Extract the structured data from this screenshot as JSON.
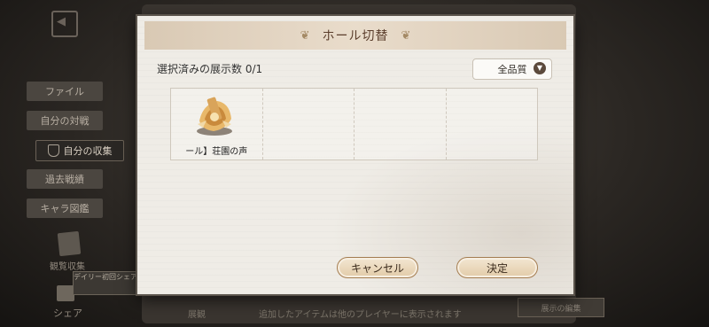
{
  "background": {
    "sidebar": [
      {
        "label": "ファイル",
        "active": false
      },
      {
        "label": "自分の対戦",
        "active": false
      },
      {
        "label": "自分の収集",
        "active": true
      },
      {
        "label": "過去戦績",
        "active": false
      },
      {
        "label": "キャラ図鑑",
        "active": false
      }
    ],
    "album_label": "観覧収集",
    "daily_label": "デイリー初回シェア",
    "share_label": "シェア",
    "bottom_left": "展観",
    "bottom_text": "追加したアイテムは他のプレイヤーに表示されます",
    "bottom_button": "展示の編集"
  },
  "dialog": {
    "title": "ホール切替",
    "selected_count": "選択済みの展示数 0/1",
    "quality_filter": "全品質",
    "slots": [
      {
        "label": "ール】荘園の声",
        "has_item": true
      },
      {
        "label": "",
        "has_item": false
      },
      {
        "label": "",
        "has_item": false
      },
      {
        "label": "",
        "has_item": false
      }
    ],
    "cancel_label": "キャンセル",
    "confirm_label": "決定"
  }
}
